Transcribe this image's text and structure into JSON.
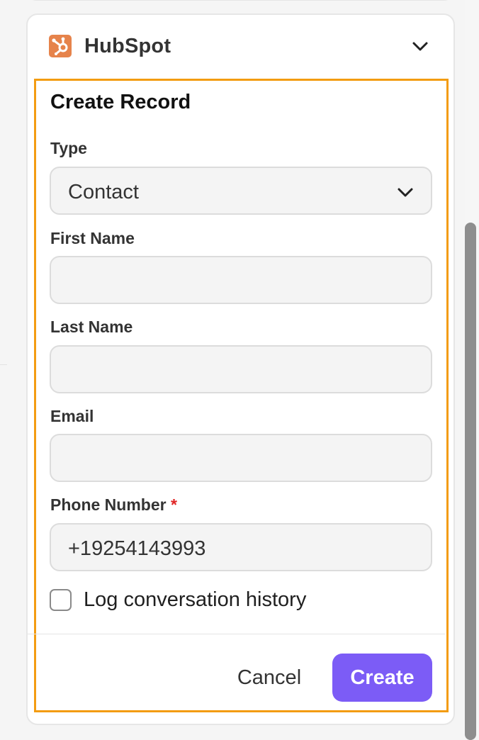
{
  "integration": {
    "name": "HubSpot",
    "logo_icon": "hubspot-logo",
    "expand_icon": "chevron-down-icon"
  },
  "form": {
    "title": "Create Record",
    "type": {
      "label": "Type",
      "value": "Contact"
    },
    "first_name": {
      "label": "First Name",
      "value": ""
    },
    "last_name": {
      "label": "Last Name",
      "value": ""
    },
    "email": {
      "label": "Email",
      "value": ""
    },
    "phone_number": {
      "label": "Phone Number",
      "required_marker": "*",
      "value": "+19254143993"
    },
    "log_conversation": {
      "label": "Log conversation history",
      "checked": false
    }
  },
  "actions": {
    "cancel_label": "Cancel",
    "create_label": "Create"
  },
  "colors": {
    "accent": "#7c5cf6",
    "highlight_border": "#f39c12",
    "brand": "#e6834b",
    "required": "#e02424"
  }
}
